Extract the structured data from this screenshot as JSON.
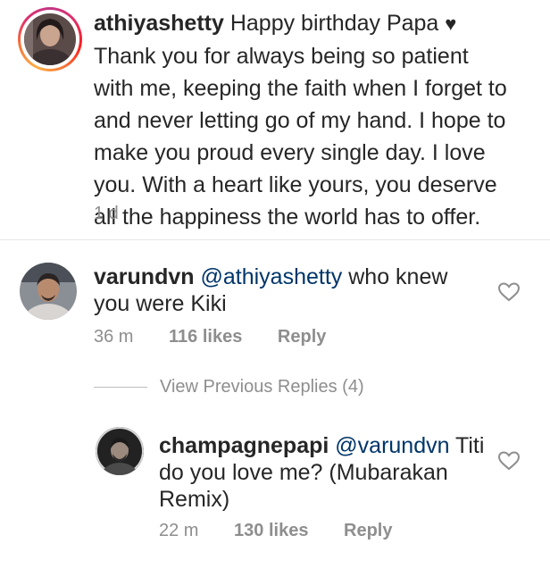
{
  "caption": {
    "username": "athiyashetty",
    "text_before_heart": "Happy birthday Papa",
    "heart_glyph": "♥",
    "text_after_heart": "Thank you for always being so patient with me, keeping the faith when I forget to and never letting go of my hand. I hope to make you proud every single day. I love you. With a heart like yours, you deserve all the happiness the world has to offer.",
    "time": "1 d"
  },
  "comment": {
    "username": "varundvn",
    "mention": "@athiyashetty",
    "text": "who knew you were Kiki",
    "time": "36 m",
    "likes": "116 likes",
    "reply": "Reply"
  },
  "view_previous_replies": "View Previous Replies (4)",
  "reply": {
    "username": "champagnepapi",
    "mention": "@varundvn",
    "text": "Titi do you love me? (Mubarakan Remix)",
    "time": "22 m",
    "likes": "130 likes",
    "reply": "Reply"
  },
  "colors": {
    "text": "#262626",
    "meta": "#8e8e8e",
    "mention": "#003569",
    "divider": "#e6e6e6"
  },
  "icons": [
    "heart-outline-icon",
    "avatar-athiyashetty",
    "avatar-varundvn",
    "avatar-champagnepapi"
  ]
}
